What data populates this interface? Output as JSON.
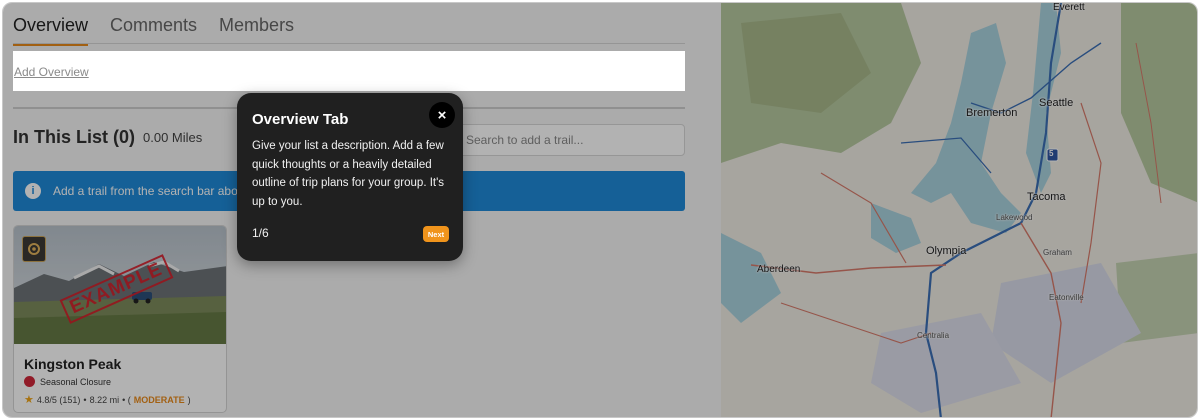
{
  "tabs": [
    {
      "label": "Overview",
      "active": true
    },
    {
      "label": "Comments",
      "active": false
    },
    {
      "label": "Members",
      "active": false
    }
  ],
  "overview": {
    "add_label": "Add Overview"
  },
  "list": {
    "title": "In This List (0)",
    "miles": "0.00 Miles",
    "search_placeholder": "Search to add a trail..."
  },
  "banner": {
    "text": "Add a trail from the search bar abo",
    "icon": "info-icon"
  },
  "card": {
    "name": "Kingston Peak",
    "stamp": "EXAMPLE",
    "status": "Seasonal Closure",
    "status_color": "#d0283a",
    "rating": "4.8/5 (151)",
    "sep": "•",
    "distance": "8.22 mi",
    "difficulty_prefix": "• (",
    "difficulty": "MODERATE",
    "difficulty_suffix": ")",
    "difficulty_color": "#e98a1b"
  },
  "tooltip": {
    "title": "Overview Tab",
    "close_icon": "×",
    "body": "Give your list a description. Add a few quick thoughts or a heavily detailed outline of trip plans for your group. It's up to you.",
    "step": "1/6",
    "next_label": "Next"
  },
  "map": {
    "cities": [
      {
        "name": "Everett"
      },
      {
        "name": "Bremerton"
      },
      {
        "name": "Seattle"
      },
      {
        "name": "Tacoma"
      },
      {
        "name": "Lakewood"
      },
      {
        "name": "Olympia"
      },
      {
        "name": "Aberdeen"
      },
      {
        "name": "Graham"
      },
      {
        "name": "Eatonville"
      },
      {
        "name": "Centralia"
      }
    ],
    "highway_shield": "5"
  },
  "colors": {
    "accent": "#e98a1b",
    "banner": "#1f8ad8",
    "tooltip_bg": "#202020"
  }
}
